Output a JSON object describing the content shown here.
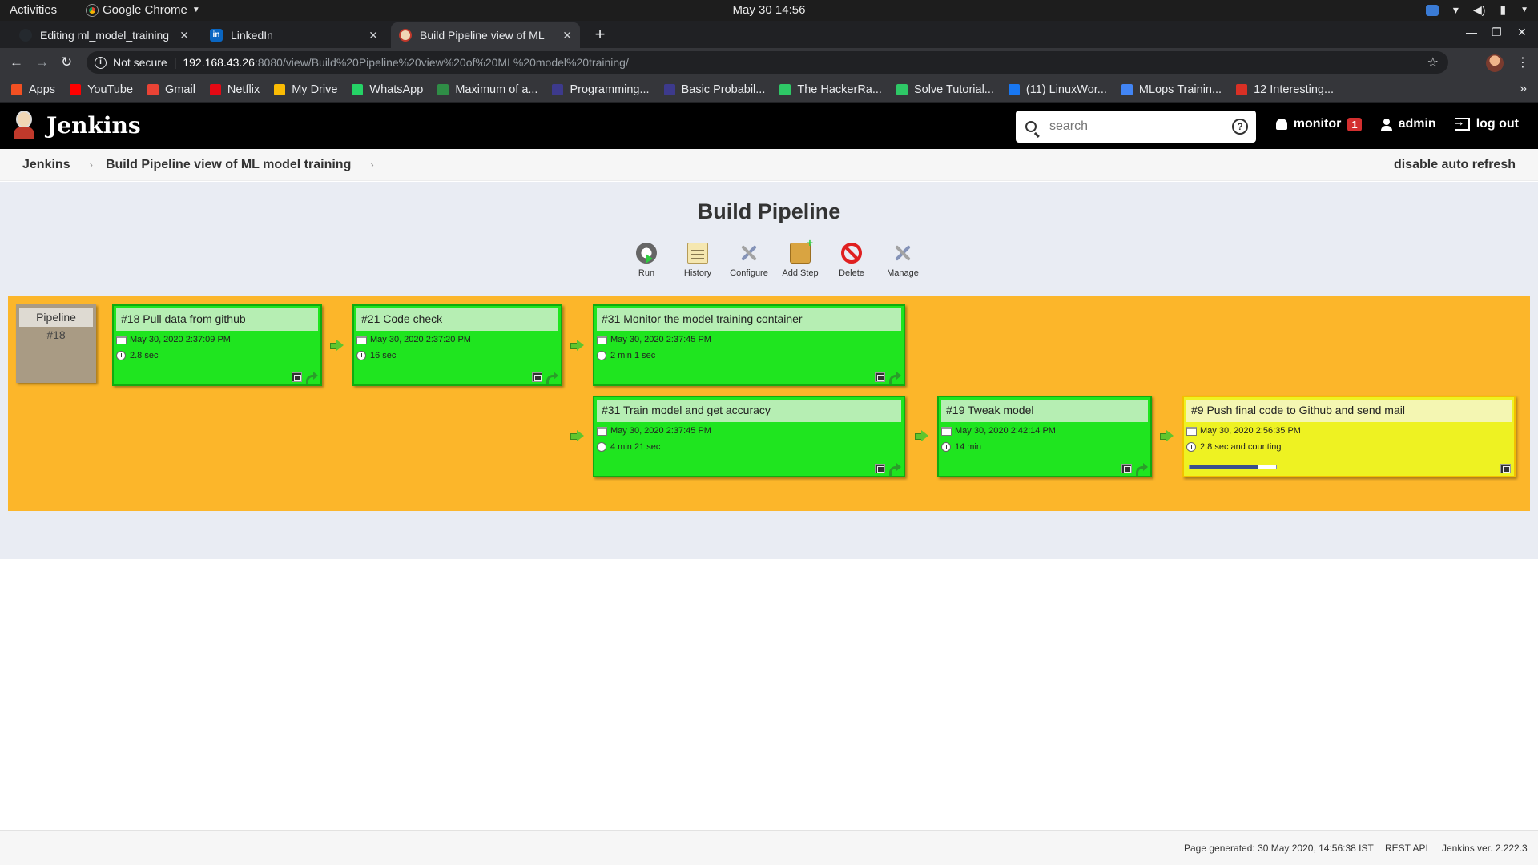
{
  "system_bar": {
    "activities": "Activities",
    "app_name": "Google Chrome",
    "clock": "May 30  14:56"
  },
  "browser": {
    "tabs": [
      {
        "title": "Editing ml_model_training",
        "favicon": "github-icon",
        "active": false
      },
      {
        "title": "LinkedIn",
        "favicon": "linkedin-icon",
        "active": false
      },
      {
        "title": "Build Pipeline view of ML",
        "favicon": "jenkins-icon",
        "active": true
      }
    ],
    "address": {
      "security_label": "Not secure",
      "host": "192.168.43.26",
      "path": ":8080/view/Build%20Pipeline%20view%20of%20ML%20model%20training/"
    },
    "bookmarks": [
      {
        "label": "Apps",
        "icon": "apps-grid-icon",
        "color": "#f25022"
      },
      {
        "label": "YouTube",
        "icon": "youtube-icon",
        "color": "#ff0000"
      },
      {
        "label": "Gmail",
        "icon": "gmail-icon",
        "color": "#ea4335"
      },
      {
        "label": "Netflix",
        "icon": "netflix-icon",
        "color": "#e50914"
      },
      {
        "label": "My Drive",
        "icon": "drive-icon",
        "color": "#fbbc04"
      },
      {
        "label": "WhatsApp",
        "icon": "whatsapp-icon",
        "color": "#25d366"
      },
      {
        "label": "Maximum of a...",
        "icon": "geeksforgeeks-icon",
        "color": "#2f8d46"
      },
      {
        "label": "Programming...",
        "icon": "bookmark-page-icon",
        "color": "#3d3a8c"
      },
      {
        "label": "Basic Probabil...",
        "icon": "bookmark-page-icon",
        "color": "#3d3a8c"
      },
      {
        "label": "The HackerRa...",
        "icon": "hackerrank-icon",
        "color": "#2ec866"
      },
      {
        "label": "Solve Tutorial...",
        "icon": "hackerrank-icon",
        "color": "#2ec866"
      },
      {
        "label": "(11) LinuxWor...",
        "icon": "facebook-icon",
        "color": "#1877f2"
      },
      {
        "label": "MLops Trainin...",
        "icon": "docs-icon",
        "color": "#4285f4"
      },
      {
        "label": "12 Interesting...",
        "icon": "bookmark-page-icon",
        "color": "#d93025"
      }
    ]
  },
  "jenkins": {
    "brand": "Jenkins",
    "search_placeholder": "search",
    "monitor_label": "monitor",
    "monitor_count": "1",
    "user": "admin",
    "logout": "log out",
    "breadcrumb": [
      "Jenkins",
      "Build Pipeline view of ML model training"
    ],
    "auto_refresh": "disable auto refresh",
    "page_title": "Build Pipeline",
    "actions": [
      {
        "label": "Run",
        "icon": "run-icon"
      },
      {
        "label": "History",
        "icon": "history-icon"
      },
      {
        "label": "Configure",
        "icon": "configure-icon"
      },
      {
        "label": "Add Step",
        "icon": "add-step-icon"
      },
      {
        "label": "Delete",
        "icon": "delete-icon"
      },
      {
        "label": "Manage",
        "icon": "manage-icon"
      }
    ],
    "pipeline": {
      "revision_label": "Pipeline",
      "revision_number": "#18",
      "builds": [
        {
          "title": "#18 Pull data from github",
          "date": "May 30, 2020 2:37:09 PM",
          "duration": "2.8 sec",
          "status": "success",
          "color": "#1fe51f"
        },
        {
          "title": "#21 Code check",
          "date": "May 30, 2020 2:37:20 PM",
          "duration": "16 sec",
          "status": "success",
          "color": "#1fe51f"
        },
        {
          "title": "#31 Monitor the model training container",
          "date": "May 30, 2020 2:37:45 PM",
          "duration": "2 min 1 sec",
          "status": "success",
          "color": "#1fe51f"
        },
        {
          "title": "#31 Train model and get accuracy",
          "date": "May 30, 2020 2:37:45 PM",
          "duration": "4 min 21 sec",
          "status": "success",
          "color": "#1fe51f"
        },
        {
          "title": "#19 Tweak model",
          "date": "May 30, 2020 2:42:14 PM",
          "duration": "14 min",
          "status": "success",
          "color": "#1fe51f"
        },
        {
          "title": "#9 Push final code to Github and send mail",
          "date": "May 30, 2020 2:56:35 PM",
          "duration": "2.8 sec and counting",
          "status": "running",
          "color": "#eef222",
          "progress_percent": 80
        }
      ],
      "background_color": "#fcb62a"
    }
  },
  "footer": {
    "generated": "Page generated: 30 May 2020, 14:56:38 IST",
    "rest_api": "REST API",
    "version": "Jenkins ver. 2.222.3"
  }
}
